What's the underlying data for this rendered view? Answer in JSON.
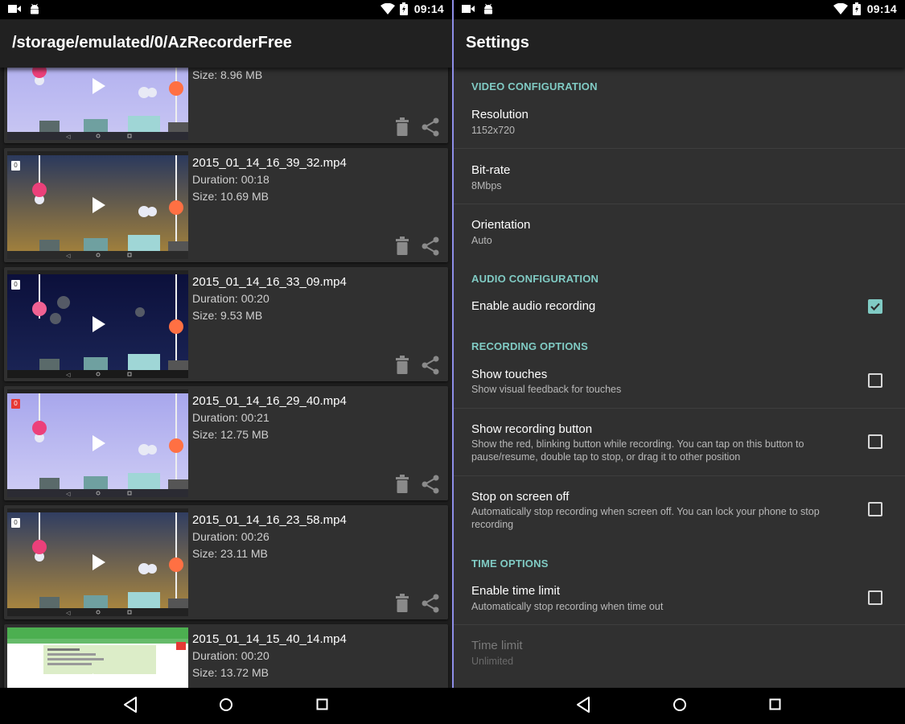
{
  "status_bar": {
    "time": "09:14"
  },
  "left_panel": {
    "title": "/storage/emulated/0/AzRecorderFree",
    "videos": [
      {
        "filename": "",
        "duration": "",
        "size": "Size: 8.96 MB",
        "theme": "day"
      },
      {
        "filename": "2015_01_14_16_39_32.mp4",
        "duration": "Duration: 00:18",
        "size": "Size: 10.69 MB",
        "badge": "0",
        "theme": "dusk"
      },
      {
        "filename": "2015_01_14_16_33_09.mp4",
        "duration": "Duration: 00:20",
        "size": "Size: 9.53 MB",
        "badge": "0",
        "theme": "night"
      },
      {
        "filename": "2015_01_14_16_29_40.mp4",
        "duration": "Duration: 00:21",
        "size": "Size: 12.75 MB",
        "badge": "0",
        "theme": "day2"
      },
      {
        "filename": "2015_01_14_16_23_58.mp4",
        "duration": "Duration: 00:26",
        "size": "Size: 23.11 MB",
        "badge": "0",
        "theme": "dusk2"
      },
      {
        "filename": "2015_01_14_15_40_14.mp4",
        "duration": "Duration: 00:20",
        "size": "Size: 13.72 MB",
        "theme": "app"
      }
    ]
  },
  "right_panel": {
    "title": "Settings",
    "categories": {
      "video": "VIDEO CONFIGURATION",
      "audio": "AUDIO CONFIGURATION",
      "recording": "RECORDING OPTIONS",
      "time": "TIME OPTIONS"
    },
    "prefs": {
      "resolution": {
        "title": "Resolution",
        "summary": "1152x720"
      },
      "bitrate": {
        "title": "Bit-rate",
        "summary": "8Mbps"
      },
      "orientation": {
        "title": "Orientation",
        "summary": "Auto"
      },
      "audio": {
        "title": "Enable audio recording",
        "checked": true
      },
      "touches": {
        "title": "Show touches",
        "summary": "Show visual feedback for touches",
        "checked": false
      },
      "rec_button": {
        "title": "Show recording button",
        "summary": "Show the red, blinking button while recording. You can tap on this button to pause/resume, double tap to stop, or drag it to other position",
        "checked": false
      },
      "screen_off": {
        "title": "Stop on screen off",
        "summary": "Automatically stop recording when screen off. You can lock your phone to stop recording",
        "checked": false
      },
      "time_limit": {
        "title": "Enable time limit",
        "summary": "Automatically stop recording when time out",
        "checked": false
      },
      "time_limit_value": {
        "title": "Time limit",
        "summary": "Unlimited",
        "enabled": false
      }
    }
  },
  "colors": {
    "accent": "#80cbc4",
    "divider": "#8e8ee8",
    "card": "#303030",
    "background": "#1e1e1e"
  },
  "icons": [
    "video-camera-icon",
    "android-icon",
    "wifi-icon",
    "battery-icon",
    "delete-icon",
    "share-icon",
    "play-icon",
    "back-icon",
    "home-icon",
    "recents-icon",
    "checkbox-icon"
  ]
}
